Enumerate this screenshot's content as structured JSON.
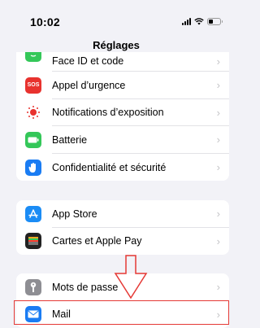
{
  "status": {
    "time": "10:02"
  },
  "nav": {
    "title": "Réglages"
  },
  "group1": [
    {
      "label": "Face ID et code",
      "icon": "face-id-icon",
      "color": "#34c759"
    },
    {
      "label": "Appel d’urgence",
      "icon": "sos-icon",
      "color": "#e8322e",
      "glyph": "SOS"
    },
    {
      "label": "Notifications d’exposition",
      "icon": "exposure-icon",
      "color": "#ffffff"
    },
    {
      "label": "Batterie",
      "icon": "battery-icon",
      "color": "#34c759"
    },
    {
      "label": "Confidentialité et sécurité",
      "icon": "hand-icon",
      "color": "#1a7cf3"
    }
  ],
  "group2": [
    {
      "label": "App Store",
      "icon": "app-store-icon",
      "color": "#1b8cf5"
    },
    {
      "label": "Cartes et Apple Pay",
      "icon": "wallet-icon",
      "color": "#222222"
    }
  ],
  "group3": [
    {
      "label": "Mots de passe",
      "icon": "key-icon",
      "color": "#8e8e93"
    },
    {
      "label": "Mail",
      "icon": "mail-icon",
      "color": "#1a7cf3"
    }
  ],
  "chevron": "›",
  "annotation": {
    "color": "#e53935"
  }
}
